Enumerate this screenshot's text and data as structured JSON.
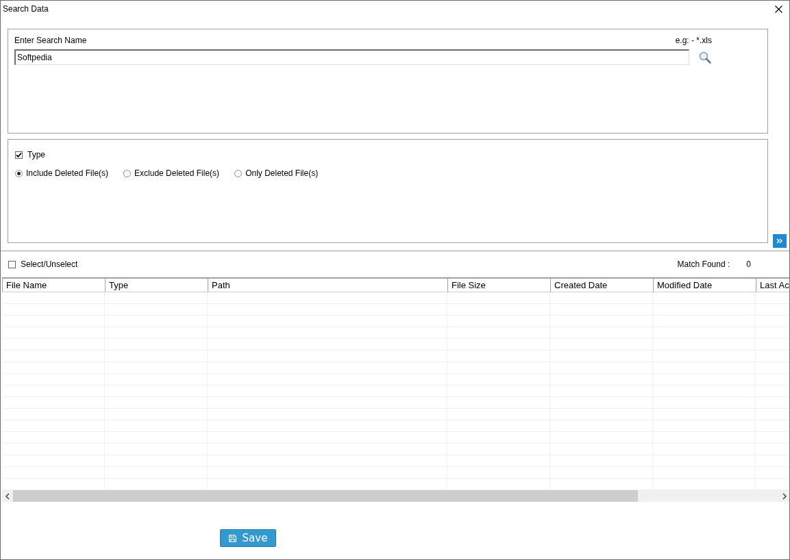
{
  "window": {
    "title": "Search Data"
  },
  "search": {
    "label": "Enter Search Name",
    "hint": "e.g: - *.xls",
    "value": "Softpedia"
  },
  "type_filter": {
    "label": "Type",
    "checked": true
  },
  "options": [
    {
      "label": "Include Deleted File(s)",
      "selected": true
    },
    {
      "label": "Exclude Deleted File(s)",
      "selected": false
    },
    {
      "label": "Only Deleted File(s)",
      "selected": false
    }
  ],
  "select_all": {
    "label": "Select/Unselect",
    "checked": false
  },
  "match_found": {
    "label": "Match Found :",
    "value": "0"
  },
  "table": {
    "columns": [
      "File Name",
      "Type",
      "Path",
      "File Size",
      "Created Date",
      "Modified Date",
      "Last Ac"
    ]
  },
  "buttons": {
    "save": "Save"
  }
}
